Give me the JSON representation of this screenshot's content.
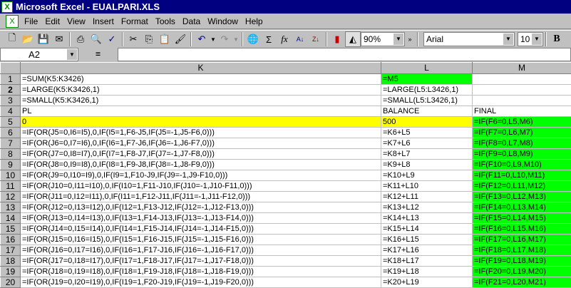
{
  "window": {
    "title": "Microsoft Excel - EUALPARI.XLS"
  },
  "menu": [
    "File",
    "Edit",
    "View",
    "Insert",
    "Format",
    "Tools",
    "Data",
    "Window",
    "Help"
  ],
  "toolbar": {
    "zoom": "90%",
    "font": "Arial",
    "size": "10",
    "bold": "B"
  },
  "formula_bar": {
    "name_box": "A2",
    "equals": "=",
    "formula": ""
  },
  "columns": [
    "K",
    "L",
    "M"
  ],
  "colors": {
    "yellow": "#ffff00",
    "green": "#00ff00"
  },
  "rows": [
    {
      "n": "1",
      "K": "=SUM(K5:K3426)",
      "L": "=M5",
      "M": ""
    },
    {
      "n": "2",
      "K": "=LARGE(K5:K3426,1)",
      "L": "=LARGE(L5:L3426,1)",
      "M": ""
    },
    {
      "n": "3",
      "K": "=SMALL(K5:K3426,1)",
      "L": "=SMALL(L5:L3426,1)",
      "M": ""
    },
    {
      "n": "4",
      "K": "PL",
      "L": "BALANCE",
      "M": "FINAL"
    },
    {
      "n": "5",
      "K": "0",
      "L": "500",
      "M": "=IF(F6=0,L5,M6)"
    },
    {
      "n": "6",
      "K": "=IF(OR(J5=0,I6=I5),0,IF(I5=1,F6-J5,IF(J5=-1,J5-F6,0)))",
      "L": "=K6+L5",
      "M": "=IF(F7=0,L6,M7)"
    },
    {
      "n": "7",
      "K": "=IF(OR(J6=0,I7=I6),0,IF(I6=1,F7-J6,IF(J6=-1,J6-F7,0)))",
      "L": "=K7+L6",
      "M": "=IF(F8=0,L7,M8)"
    },
    {
      "n": "8",
      "K": "=IF(OR(J7=0,I8=I7),0,IF(I7=1,F8-J7,IF(J7=-1,J7-F8,0)))",
      "L": "=K8+L7",
      "M": "=IF(F9=0,L8,M9)"
    },
    {
      "n": "9",
      "K": "=IF(OR(J8=0,I9=I8),0,IF(I8=1,F9-J8,IF(J8=-1,J8-F9,0)))",
      "L": "=K9+L8",
      "M": "=IF(F10=0,L9,M10)"
    },
    {
      "n": "10",
      "K": "=IF(OR(J9=0,I10=I9),0,IF(I9=1,F10-J9,IF(J9=-1,J9-F10,0)))",
      "L": "=K10+L9",
      "M": "=IF(F11=0,L10,M11)"
    },
    {
      "n": "11",
      "K": "=IF(OR(J10=0,I11=I10),0,IF(I10=1,F11-J10,IF(J10=-1,J10-F11,0)))",
      "L": "=K11+L10",
      "M": "=IF(F12=0,L11,M12)"
    },
    {
      "n": "12",
      "K": "=IF(OR(J11=0,I12=I11),0,IF(I11=1,F12-J11,IF(J11=-1,J11-F12,0)))",
      "L": "=K12+L11",
      "M": "=IF(F13=0,L12,M13)"
    },
    {
      "n": "13",
      "K": "=IF(OR(J12=0,I13=I12),0,IF(I12=1,F13-J12,IF(J12=-1,J12-F13,0)))",
      "L": "=K13+L12",
      "M": "=IF(F14=0,L13,M14)"
    },
    {
      "n": "14",
      "K": "=IF(OR(J13=0,I14=I13),0,IF(I13=1,F14-J13,IF(J13=-1,J13-F14,0)))",
      "L": "=K14+L13",
      "M": "=IF(F15=0,L14,M15)"
    },
    {
      "n": "15",
      "K": "=IF(OR(J14=0,I15=I14),0,IF(I14=1,F15-J14,IF(J14=-1,J14-F15,0)))",
      "L": "=K15+L14",
      "M": "=IF(F16=0,L15,M16)"
    },
    {
      "n": "16",
      "K": "=IF(OR(J15=0,I16=I15),0,IF(I15=1,F16-J15,IF(J15=-1,J15-F16,0)))",
      "L": "=K16+L15",
      "M": "=IF(F17=0,L16,M17)"
    },
    {
      "n": "17",
      "K": "=IF(OR(J16=0,I17=I16),0,IF(I16=1,F17-J16,IF(J16=-1,J16-F17,0)))",
      "L": "=K17+L16",
      "M": "=IF(F18=0,L17,M18)"
    },
    {
      "n": "18",
      "K": "=IF(OR(J17=0,I18=I17),0,IF(I17=1,F18-J17,IF(J17=-1,J17-F18,0)))",
      "L": "=K18+L17",
      "M": "=IF(F19=0,L18,M19)"
    },
    {
      "n": "19",
      "K": "=IF(OR(J18=0,I19=I18),0,IF(I18=1,F19-J18,IF(J18=-1,J18-F19,0)))",
      "L": "=K19+L18",
      "M": "=IF(F20=0,L19,M20)"
    },
    {
      "n": "20",
      "K": "=IF(OR(J19=0,I20=I19),0,IF(I19=1,F20-J19,IF(J19=-1,J19-F20,0)))",
      "L": "=K20+L19",
      "M": "=IF(F21=0,L20,M21)"
    }
  ]
}
